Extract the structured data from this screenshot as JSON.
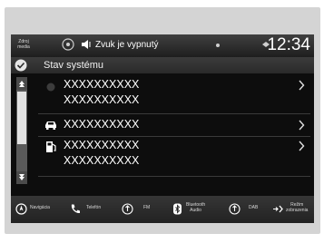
{
  "status_bar": {
    "left_label_line1": "Zdroj",
    "left_label_line2": "media",
    "sound_status": "Zvuk je vypnutý",
    "time": "12:34"
  },
  "header": {
    "title": "Stav systému"
  },
  "list": {
    "items": [
      {
        "line1": "XXXXXXXXXX",
        "line2": "XXXXXXXXXX",
        "icon": "info-dot-icon"
      },
      {
        "line1": "XXXXXXXXXX",
        "line2": "",
        "icon": "car-icon"
      },
      {
        "line1": "XXXXXXXXXX",
        "line2": "XXXXXXXXXX",
        "icon": "fuel-pump-icon"
      }
    ]
  },
  "bottom_nav": {
    "items": [
      {
        "label": "Navigácia",
        "icon": "navigation-icon"
      },
      {
        "label": "Telefón",
        "icon": "phone-icon"
      },
      {
        "label": "FM",
        "icon": "radio-icon"
      },
      {
        "label_line1": "Bluetooth",
        "label_line2": "Audio",
        "icon": "bluetooth-icon"
      },
      {
        "label": "DAB",
        "icon": "dab-radio-icon"
      },
      {
        "label_line1": "Režim",
        "label_line2": "zobrazenia",
        "icon": "display-mode-icon"
      }
    ]
  },
  "colors": {
    "screen_bg": "#0d0d0d",
    "bar_bg": "#2e2e2e",
    "text": "#ffffff",
    "frame": "#d4d4d4"
  }
}
